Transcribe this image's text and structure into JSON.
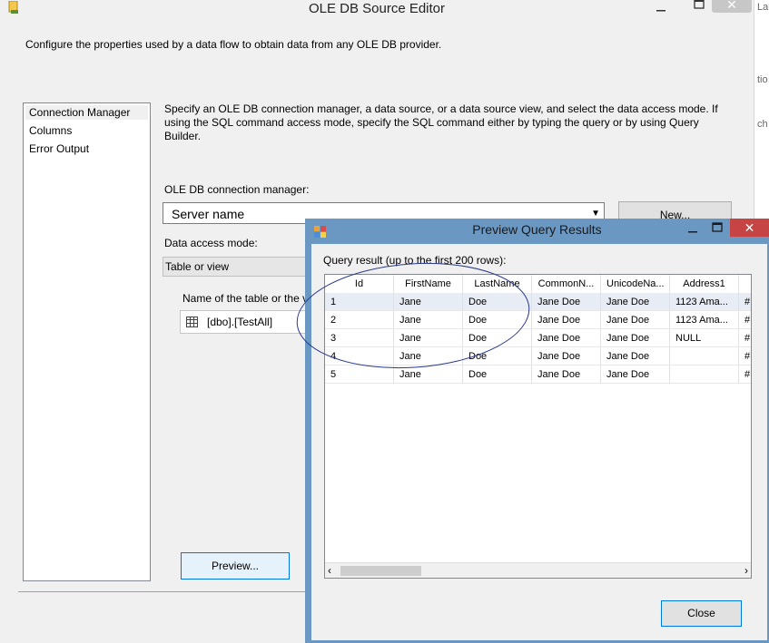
{
  "editor": {
    "title": "OLE DB Source Editor",
    "description": "Configure the properties used by a data flow to obtain data from any OLE DB provider.",
    "nav": [
      "Connection Manager",
      "Columns",
      "Error Output"
    ],
    "instructions": "Specify an OLE DB connection manager, a data source, or a data source view, and select the data access mode. If using the SQL command access mode, specify the SQL command either by typing the query or by using Query Builder.",
    "connection_label": "OLE DB connection manager:",
    "connection_value": "Server name",
    "new_button": "New...",
    "access_mode_label": "Data access mode:",
    "access_mode_value": "Table or view",
    "table_label": "Name of the table or the v",
    "table_value": "[dbo].[TestAll]",
    "preview_button": "Preview..."
  },
  "background_window": {
    "fragments": [
      "Lau",
      "tio",
      "ch"
    ]
  },
  "preview_dialog": {
    "title": "Preview Query Results",
    "query_label": "Query result (up to the first 200 rows):",
    "columns": [
      "Id",
      "FirstName",
      "LastName",
      "CommonN...",
      "UnicodeNa...",
      "Address1",
      ""
    ],
    "rows": [
      [
        "1",
        "Jane",
        "Doe",
        "Jane Doe",
        "Jane Doe",
        "1123 Ama...",
        "#"
      ],
      [
        "2",
        "Jane",
        "Doe",
        "Jane Doe",
        "Jane Doe",
        "1123 Ama...",
        "#"
      ],
      [
        "3",
        "Jane",
        "Doe",
        "Jane Doe",
        "Jane Doe",
        "NULL",
        "#"
      ],
      [
        "4",
        "Jane",
        "Doe",
        "Jane Doe",
        "Jane Doe",
        "",
        "#"
      ],
      [
        "5",
        "Jane",
        "Doe",
        "Jane Doe",
        "Jane Doe",
        "",
        "#"
      ]
    ],
    "close_button": "Close"
  },
  "colors": {
    "dialog_frame": "#6b98c2",
    "close_red": "#c74444",
    "focus_blue": "#0078d7",
    "annotation": "#2b3a8f"
  },
  "icons": {
    "editor": "ssis-source-icon",
    "table": "table-grid-icon",
    "dialog": "preview-window-icon"
  }
}
